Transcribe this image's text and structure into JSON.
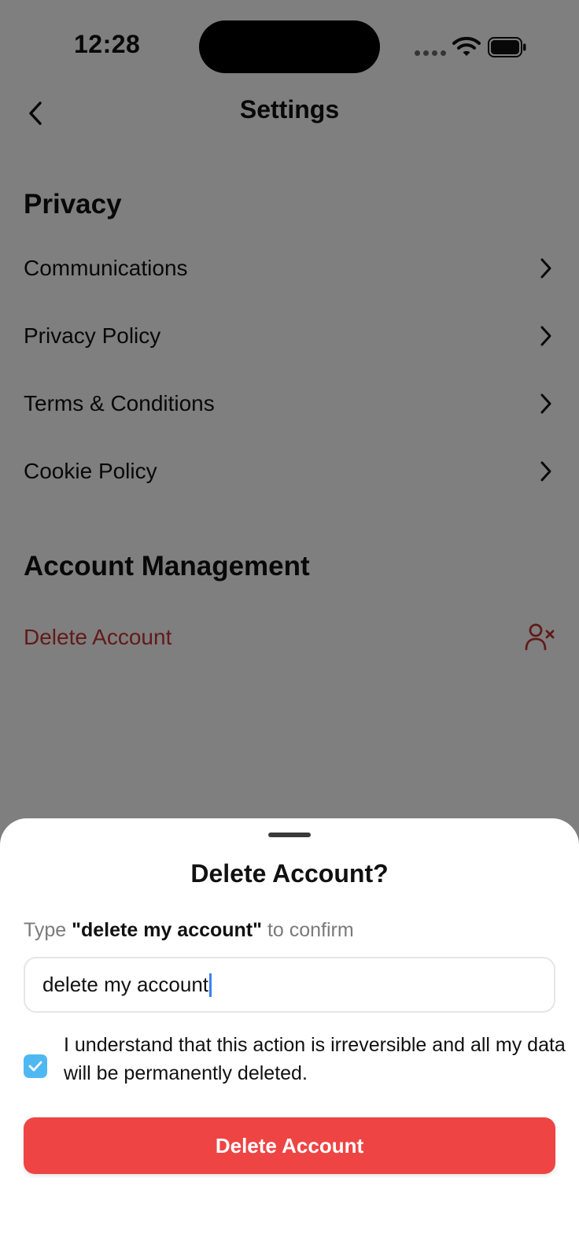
{
  "status_bar": {
    "time": "12:28"
  },
  "header": {
    "title": "Settings"
  },
  "privacy": {
    "title": "Privacy",
    "items": [
      {
        "label": "Communications"
      },
      {
        "label": "Privacy Policy"
      },
      {
        "label": "Terms & Conditions"
      },
      {
        "label": "Cookie Policy"
      }
    ]
  },
  "account_management": {
    "title": "Account Management",
    "delete_label": "Delete Account"
  },
  "sheet": {
    "title": "Delete Account?",
    "hint_prefix": "Type ",
    "hint_phrase": "\"delete my account\"",
    "hint_suffix": " to confirm",
    "input_value": "delete my account",
    "checkbox_checked": true,
    "checkbox_label": "I understand that this action is irreversible and all my data will be permanently deleted.",
    "button_label": "Delete Account"
  },
  "colors": {
    "danger": "#ef4444",
    "danger_text": "#c53434",
    "checkbox": "#4fb8f2"
  }
}
